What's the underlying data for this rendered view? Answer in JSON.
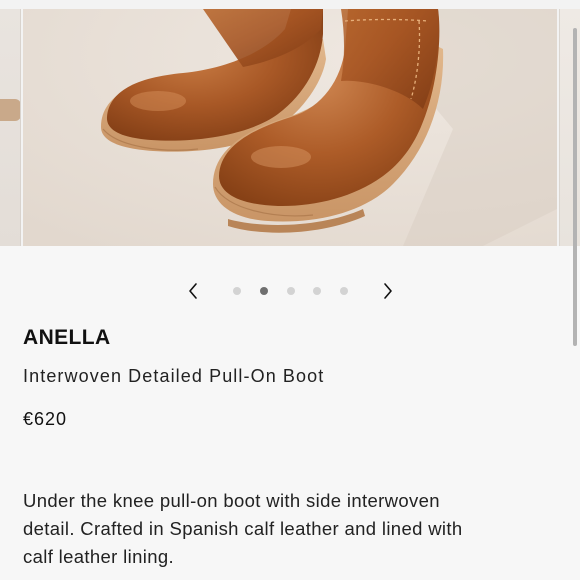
{
  "gallery": {
    "image_alt": "Brown leather pull-on boots",
    "slide_count": 5,
    "active_index": 1
  },
  "product": {
    "brand": "ANELLA",
    "name": "Interwoven Detailed Pull-On Boot",
    "price": "€620",
    "description_lines": [
      "Under the knee pull-on boot with side interwoven",
      "detail. Crafted in Spanish calf leather and lined with",
      "calf leather lining."
    ]
  },
  "icons": {
    "prev": "chevron-left-icon",
    "next": "chevron-right-icon"
  },
  "colors": {
    "background": "#f7f7f7",
    "text": "#111111",
    "dot_inactive": "#d3d3d3",
    "dot_active": "#6f6f6f",
    "leather": "#a55726"
  }
}
